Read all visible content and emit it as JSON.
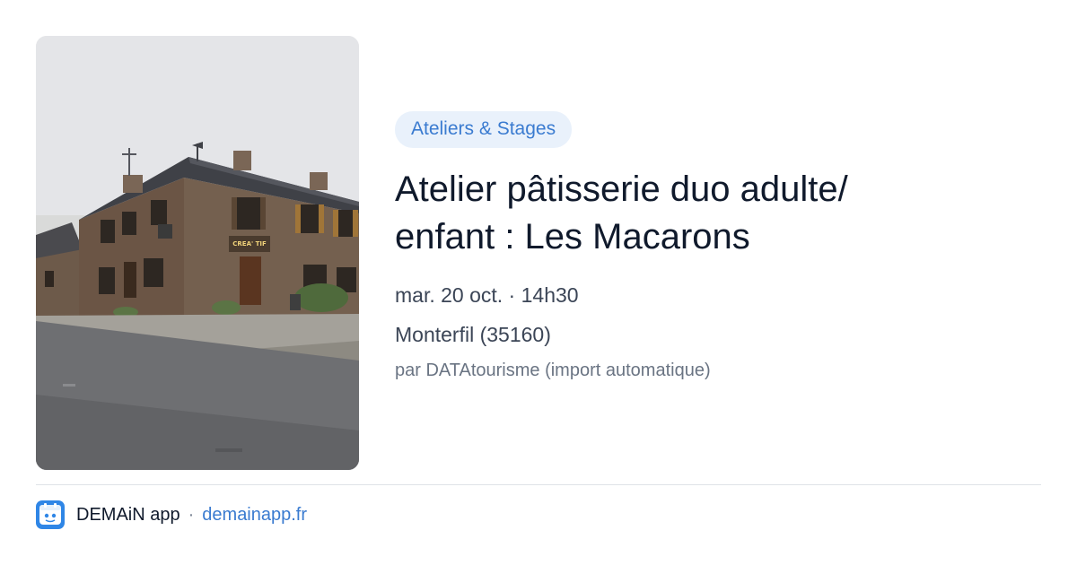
{
  "event": {
    "category": "Ateliers & Stages",
    "title_line1": "Atelier pâtisserie duo adulte/",
    "title_line2": "enfant : Les Macarons",
    "date": "mar. 20 oct. · 14h30",
    "location": "Monterfil (35160)",
    "source": "par DATAtourisme (import automatique)",
    "photo": {
      "sign_text": "CREA' TIF"
    }
  },
  "footer": {
    "app_name": "DEMAiN app",
    "separator": "·",
    "domain": "demainapp.fr",
    "icon": "app-logo-icon"
  },
  "colors": {
    "accent": "#3a7bd0",
    "badge_bg": "#e9f1fb",
    "app_icon_bg": "#2f86e6"
  }
}
